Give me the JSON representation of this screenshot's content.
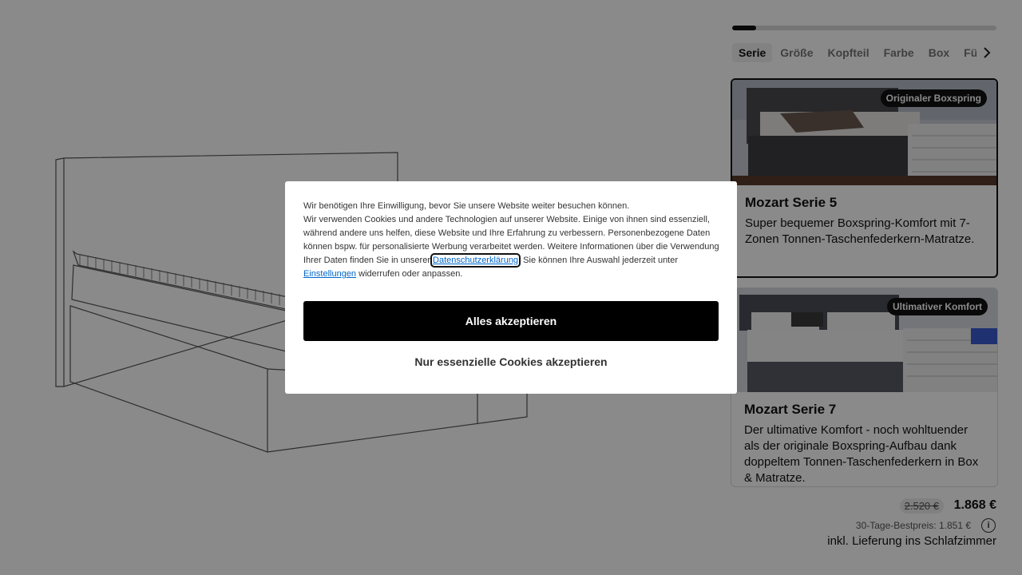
{
  "configurator": {
    "progress_fraction": 0.09,
    "steps": [
      "Serie",
      "Größe",
      "Kopfteil",
      "Farbe",
      "Box",
      "Füß"
    ],
    "active_step": "Serie",
    "products": [
      {
        "badge": "Originaler Boxspring",
        "title": "Mozart Serie 5",
        "description": "Super bequemer Boxspring-Komfort mit 7-Zonen Tonnen-Taschenfederkern-Matratze.",
        "selected": true
      },
      {
        "badge": "Ultimativer Komfort",
        "title": "Mozart Serie 7",
        "description": "Der ultimative Komfort - noch wohltuender als der originale Boxspring-Aufbau dank doppeltem Tonnen-Taschenfederkern in Box & Matratze.",
        "selected": false
      }
    ],
    "price": {
      "old": "2.520 €",
      "current": "1.868 €",
      "best_30_days": "30-Tage-Bestpreis: 1.851 €",
      "delivery": "inkl. Lieferung ins Schlafzimmer"
    }
  },
  "cookie_dialog": {
    "line1": "Wir benötigen Ihre Einwilligung, bevor Sie unsere Website weiter besuchen können.",
    "body_before_link": "Wir verwenden Cookies und andere Technologien auf unserer Website. Einige von ihnen sind essenziell, während andere uns helfen, diese Website und Ihre Erfahrung zu verbessern. Personenbezogene Daten können bspw. für personalisierte Werbung verarbeitet werden. Weitere Informationen über die Verwendung Ihrer Daten finden Sie in unserer ",
    "privacy_link": "Datenschutzerklärung",
    "body_after_link": ". Sie können Ihre Auswahl jederzeit unter ",
    "settings_link": "Einstellungen",
    "body_end": " widerrufen oder anpassen.",
    "accept_all": "Alles akzeptieren",
    "accept_essential": "Nur essenzielle Cookies akzeptieren"
  }
}
